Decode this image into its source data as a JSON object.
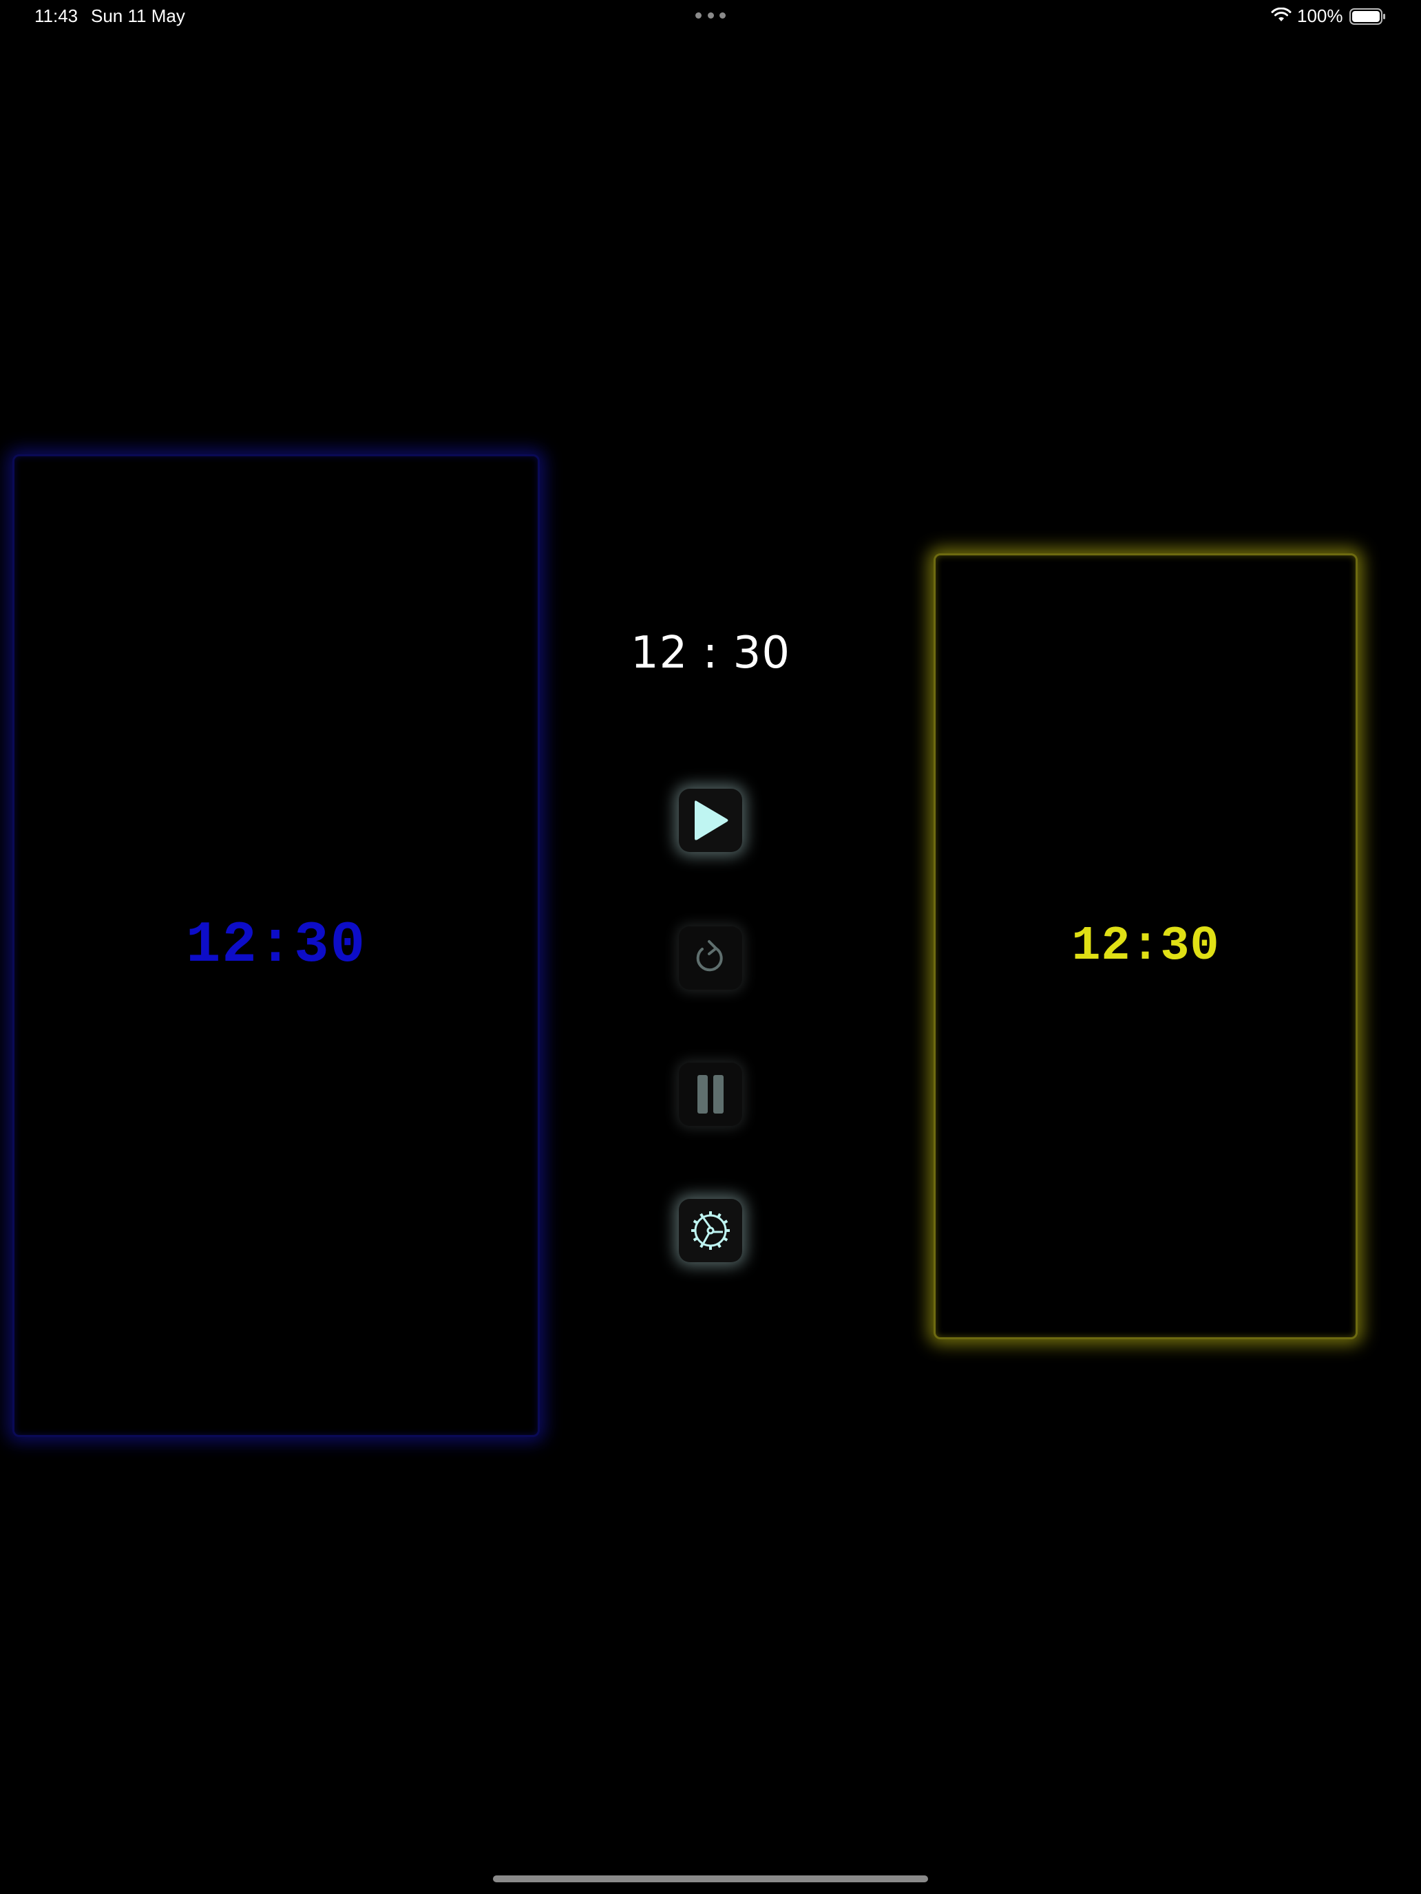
{
  "status_bar": {
    "time": "11:43",
    "date": "Sun 11 May",
    "battery_percent": "100%",
    "icons": [
      "wifi-icon",
      "battery-icon"
    ],
    "multitask_indicator": "more-dots-icon"
  },
  "player_left": {
    "time": "12:30",
    "color": "#0d0dc8",
    "state": "inactive"
  },
  "player_right": {
    "time": "12:30",
    "color": "#e0e015",
    "state": "active"
  },
  "center": {
    "game_time": "12 : 30",
    "controls": [
      {
        "name": "play",
        "icon": "play-icon",
        "state": "enabled"
      },
      {
        "name": "restart",
        "icon": "restart-icon",
        "state": "disabled"
      },
      {
        "name": "pause",
        "icon": "pause-icon",
        "state": "disabled"
      },
      {
        "name": "settings",
        "icon": "gear-icon",
        "state": "enabled"
      }
    ],
    "accent_color": "#bff5f2"
  }
}
